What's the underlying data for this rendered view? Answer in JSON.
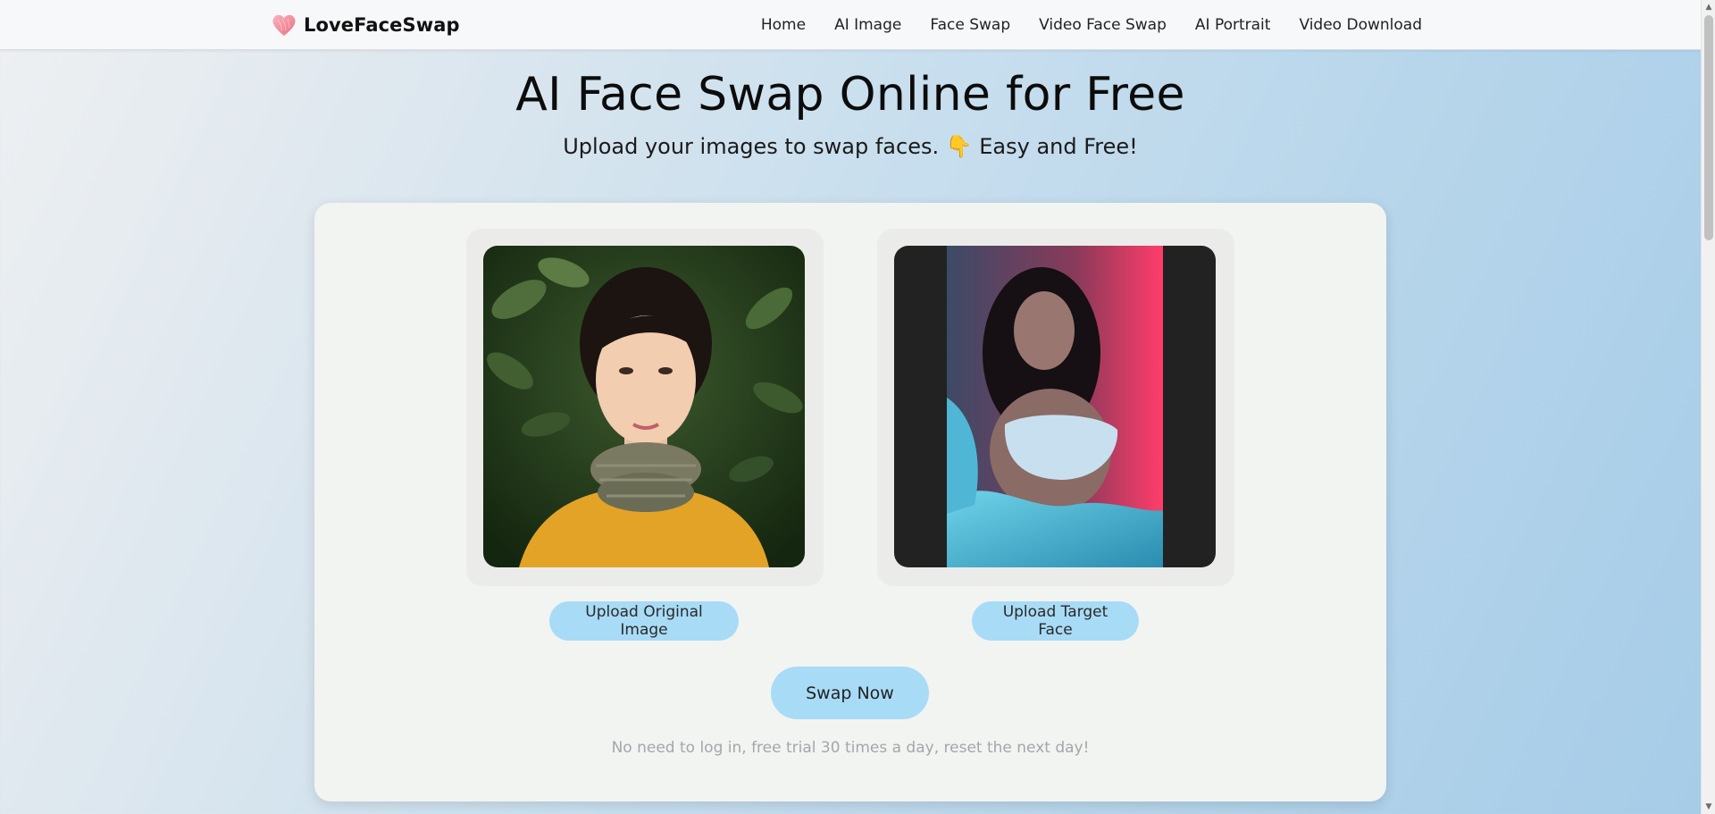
{
  "brand": {
    "name": "LoveFaceSwap",
    "icon": "heart-icon",
    "accent": "#f08a9a"
  },
  "nav": {
    "items": [
      "Home",
      "AI Image",
      "Face Swap",
      "Video Face Swap",
      "AI Portrait",
      "Video Download"
    ]
  },
  "hero": {
    "title": "AI Face Swap Online for Free",
    "subtitle": "Upload your images to swap faces. 👇 Easy and Free!"
  },
  "uploader": {
    "original_button": "Upload Original Image",
    "target_button": "Upload Target Face",
    "swap_button": "Swap Now",
    "note": "No need to log in, free trial 30 times a day, reset the next day!"
  },
  "colors": {
    "button": "#a8dbf6",
    "card": "#f2f4f2"
  },
  "scrollbar": {
    "up_icon": "▲",
    "down_icon": "▼"
  }
}
